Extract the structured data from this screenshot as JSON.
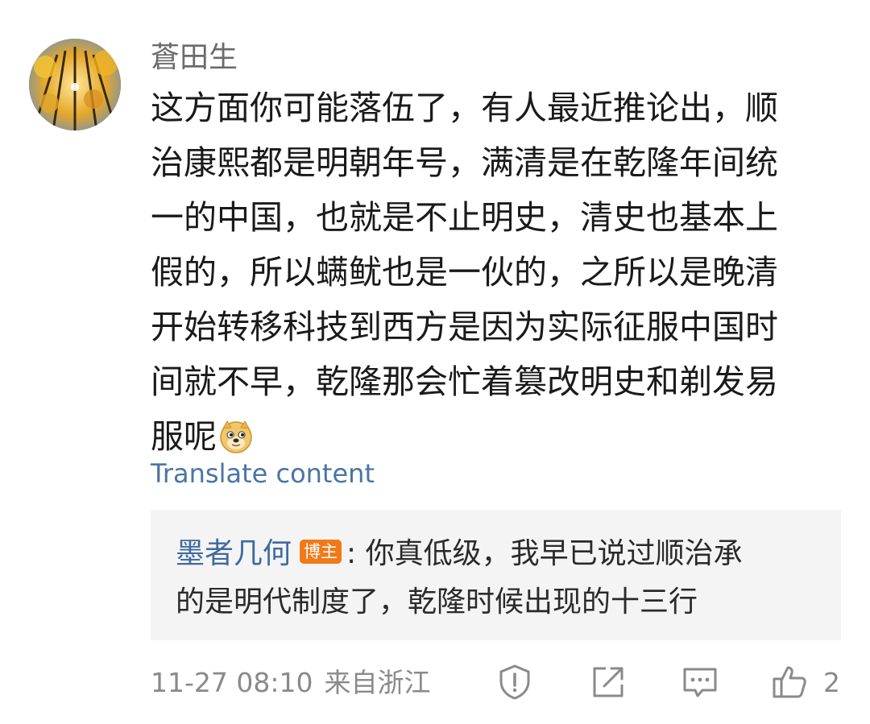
{
  "comment": {
    "username": "蒼田生",
    "lines": [
      "这方面你可能落伍了，有人最近推论出，顺",
      "治康熙都是明朝年号，满清是在乾隆年间统",
      "一的中国，也就是不止明史，清史也基本上",
      "假的，所以螨鱿也是一伙的，之所以是晚清",
      "开始转移科技到西方是因为实际征服中国时",
      "间就不早，乾隆那会忙着篡改明史和剃发易",
      "服呢"
    ],
    "emoji_icon": "doge-emoji-icon",
    "translate_label": "Translate content"
  },
  "reply": {
    "author": "墨者几何",
    "badge": "博主",
    "line1_text": ":  你真低级，我早已说过顺治承",
    "line2_text": "的是明代制度了，乾隆时候出现的十三行"
  },
  "footer": {
    "date": "11-27 08:10",
    "location": "来自浙江",
    "like_count": "2",
    "icons": [
      "report-icon",
      "share-icon",
      "comment-icon",
      "like-icon"
    ]
  },
  "colors": {
    "link": "#4a74a5",
    "reply_author": "#3f6aa0",
    "badge_bg": "#f07a1a",
    "meta_gray": "#8a8a8a",
    "reply_bg": "#f4f4f4"
  }
}
